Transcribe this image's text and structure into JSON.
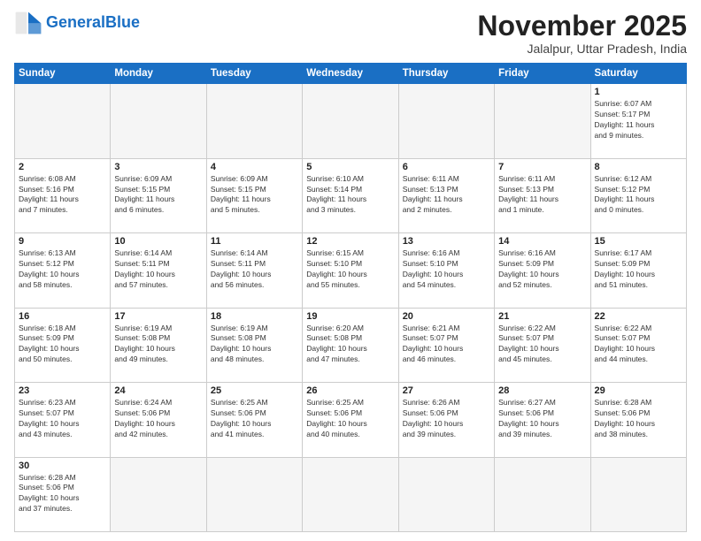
{
  "header": {
    "logo_general": "General",
    "logo_blue": "Blue",
    "title": "November 2025",
    "subtitle": "Jalalpur, Uttar Pradesh, India"
  },
  "weekdays": [
    "Sunday",
    "Monday",
    "Tuesday",
    "Wednesday",
    "Thursday",
    "Friday",
    "Saturday"
  ],
  "weeks": [
    [
      {
        "day": "",
        "info": ""
      },
      {
        "day": "",
        "info": ""
      },
      {
        "day": "",
        "info": ""
      },
      {
        "day": "",
        "info": ""
      },
      {
        "day": "",
        "info": ""
      },
      {
        "day": "",
        "info": ""
      },
      {
        "day": "1",
        "info": "Sunrise: 6:07 AM\nSunset: 5:17 PM\nDaylight: 11 hours\nand 9 minutes."
      }
    ],
    [
      {
        "day": "2",
        "info": "Sunrise: 6:08 AM\nSunset: 5:16 PM\nDaylight: 11 hours\nand 7 minutes."
      },
      {
        "day": "3",
        "info": "Sunrise: 6:09 AM\nSunset: 5:15 PM\nDaylight: 11 hours\nand 6 minutes."
      },
      {
        "day": "4",
        "info": "Sunrise: 6:09 AM\nSunset: 5:15 PM\nDaylight: 11 hours\nand 5 minutes."
      },
      {
        "day": "5",
        "info": "Sunrise: 6:10 AM\nSunset: 5:14 PM\nDaylight: 11 hours\nand 3 minutes."
      },
      {
        "day": "6",
        "info": "Sunrise: 6:11 AM\nSunset: 5:13 PM\nDaylight: 11 hours\nand 2 minutes."
      },
      {
        "day": "7",
        "info": "Sunrise: 6:11 AM\nSunset: 5:13 PM\nDaylight: 11 hours\nand 1 minute."
      },
      {
        "day": "8",
        "info": "Sunrise: 6:12 AM\nSunset: 5:12 PM\nDaylight: 11 hours\nand 0 minutes."
      }
    ],
    [
      {
        "day": "9",
        "info": "Sunrise: 6:13 AM\nSunset: 5:12 PM\nDaylight: 10 hours\nand 58 minutes."
      },
      {
        "day": "10",
        "info": "Sunrise: 6:14 AM\nSunset: 5:11 PM\nDaylight: 10 hours\nand 57 minutes."
      },
      {
        "day": "11",
        "info": "Sunrise: 6:14 AM\nSunset: 5:11 PM\nDaylight: 10 hours\nand 56 minutes."
      },
      {
        "day": "12",
        "info": "Sunrise: 6:15 AM\nSunset: 5:10 PM\nDaylight: 10 hours\nand 55 minutes."
      },
      {
        "day": "13",
        "info": "Sunrise: 6:16 AM\nSunset: 5:10 PM\nDaylight: 10 hours\nand 54 minutes."
      },
      {
        "day": "14",
        "info": "Sunrise: 6:16 AM\nSunset: 5:09 PM\nDaylight: 10 hours\nand 52 minutes."
      },
      {
        "day": "15",
        "info": "Sunrise: 6:17 AM\nSunset: 5:09 PM\nDaylight: 10 hours\nand 51 minutes."
      }
    ],
    [
      {
        "day": "16",
        "info": "Sunrise: 6:18 AM\nSunset: 5:09 PM\nDaylight: 10 hours\nand 50 minutes."
      },
      {
        "day": "17",
        "info": "Sunrise: 6:19 AM\nSunset: 5:08 PM\nDaylight: 10 hours\nand 49 minutes."
      },
      {
        "day": "18",
        "info": "Sunrise: 6:19 AM\nSunset: 5:08 PM\nDaylight: 10 hours\nand 48 minutes."
      },
      {
        "day": "19",
        "info": "Sunrise: 6:20 AM\nSunset: 5:08 PM\nDaylight: 10 hours\nand 47 minutes."
      },
      {
        "day": "20",
        "info": "Sunrise: 6:21 AM\nSunset: 5:07 PM\nDaylight: 10 hours\nand 46 minutes."
      },
      {
        "day": "21",
        "info": "Sunrise: 6:22 AM\nSunset: 5:07 PM\nDaylight: 10 hours\nand 45 minutes."
      },
      {
        "day": "22",
        "info": "Sunrise: 6:22 AM\nSunset: 5:07 PM\nDaylight: 10 hours\nand 44 minutes."
      }
    ],
    [
      {
        "day": "23",
        "info": "Sunrise: 6:23 AM\nSunset: 5:07 PM\nDaylight: 10 hours\nand 43 minutes."
      },
      {
        "day": "24",
        "info": "Sunrise: 6:24 AM\nSunset: 5:06 PM\nDaylight: 10 hours\nand 42 minutes."
      },
      {
        "day": "25",
        "info": "Sunrise: 6:25 AM\nSunset: 5:06 PM\nDaylight: 10 hours\nand 41 minutes."
      },
      {
        "day": "26",
        "info": "Sunrise: 6:25 AM\nSunset: 5:06 PM\nDaylight: 10 hours\nand 40 minutes."
      },
      {
        "day": "27",
        "info": "Sunrise: 6:26 AM\nSunset: 5:06 PM\nDaylight: 10 hours\nand 39 minutes."
      },
      {
        "day": "28",
        "info": "Sunrise: 6:27 AM\nSunset: 5:06 PM\nDaylight: 10 hours\nand 39 minutes."
      },
      {
        "day": "29",
        "info": "Sunrise: 6:28 AM\nSunset: 5:06 PM\nDaylight: 10 hours\nand 38 minutes."
      }
    ],
    [
      {
        "day": "30",
        "info": "Sunrise: 6:28 AM\nSunset: 5:06 PM\nDaylight: 10 hours\nand 37 minutes."
      },
      {
        "day": "",
        "info": ""
      },
      {
        "day": "",
        "info": ""
      },
      {
        "day": "",
        "info": ""
      },
      {
        "day": "",
        "info": ""
      },
      {
        "day": "",
        "info": ""
      },
      {
        "day": "",
        "info": ""
      }
    ]
  ]
}
